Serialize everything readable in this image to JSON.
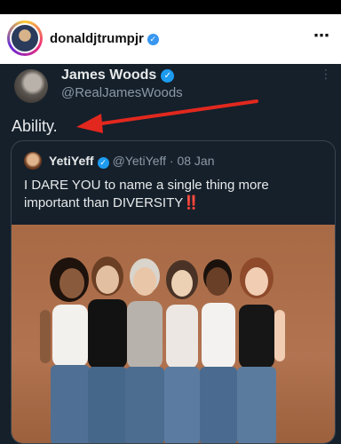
{
  "instagram": {
    "username": "donaldjtrumpjr",
    "verified_mark": "✓",
    "more_icon": "⋯"
  },
  "tweet": {
    "author_name": "James Woods",
    "author_handle": "@RealJamesWoods",
    "verified_mark": "✓",
    "more_icon": "⋮",
    "text": "Ability."
  },
  "quoted_tweet": {
    "author_name": "YetiYeff",
    "verified_mark": "✓",
    "author_handle": "@YetiYeff",
    "separator": "·",
    "date": "08 Jan",
    "text": "I DARE YOU to name a single thing more important than DIVERSITY",
    "emphasis": "‼️"
  },
  "colors": {
    "tweet_bg": "#15202b",
    "verified_blue": "#1d9bf0",
    "arrow_red": "#e2281e",
    "photo_bg": "#a86a45"
  }
}
